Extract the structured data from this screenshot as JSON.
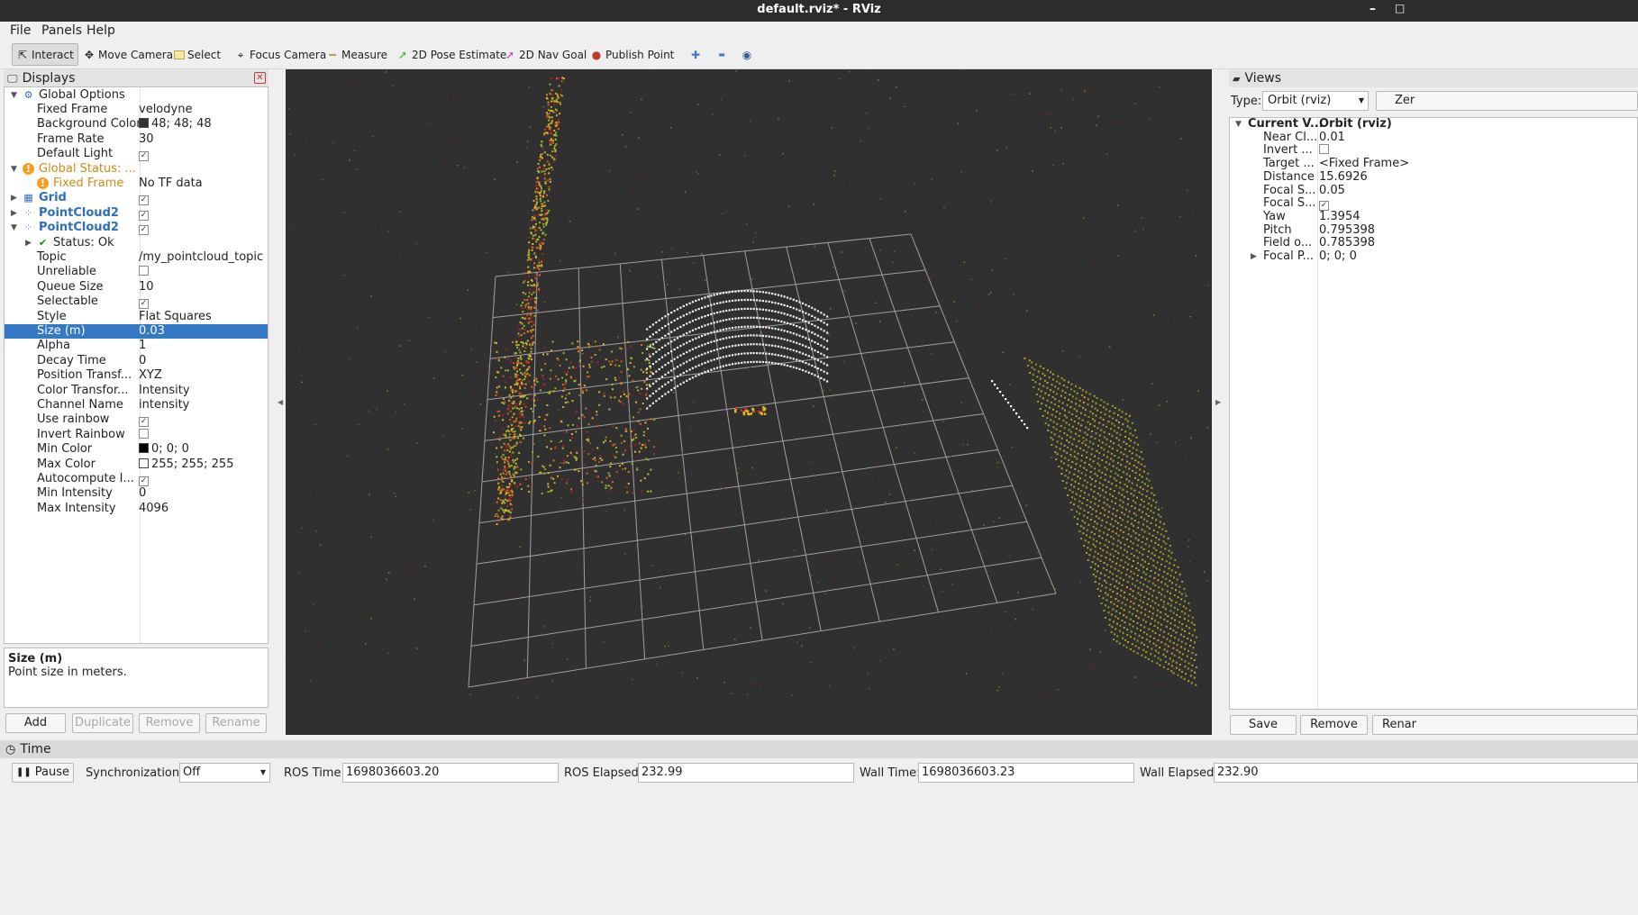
{
  "window": {
    "title": "default.rviz* - RViz",
    "min_glyph": "–",
    "max_glyph": "□"
  },
  "menu": [
    {
      "label": "File"
    },
    {
      "label": "Panels"
    },
    {
      "label": "Help"
    }
  ],
  "toolbar": {
    "tools": [
      {
        "label": "Interact",
        "icon": "cursor-icon",
        "glyph": "⇱"
      },
      {
        "label": "Move Camera",
        "icon": "move-camera-icon",
        "glyph": "✥"
      },
      {
        "label": "Select",
        "icon": "select-icon",
        "glyph": "▭"
      },
      {
        "label": "Focus Camera",
        "icon": "focus-camera-icon",
        "glyph": "⌖"
      },
      {
        "label": "Measure",
        "icon": "measure-icon",
        "glyph": "━"
      },
      {
        "label": "2D Pose Estimate",
        "icon": "pose-estimate-icon",
        "glyph": "➚"
      },
      {
        "label": "2D Nav Goal",
        "icon": "nav-goal-icon",
        "glyph": "➚"
      },
      {
        "label": "Publish Point",
        "icon": "publish-point-icon",
        "glyph": "📍"
      }
    ],
    "extra_icons": [
      {
        "name": "add-tool-icon",
        "glyph": "✚"
      },
      {
        "name": "remove-tool-icon",
        "glyph": "▬"
      },
      {
        "name": "view-options-icon",
        "glyph": "◉"
      }
    ]
  },
  "displays": {
    "title": "Displays",
    "rows": [
      {
        "name": "Global Options",
        "value": "",
        "indent": 1,
        "arrow": "▼",
        "icon": "globe-icon",
        "glyph": "⚙",
        "style": ""
      },
      {
        "name": "Fixed Frame",
        "value": "velodyne",
        "indent": 2,
        "style": ""
      },
      {
        "name": "Background Color",
        "value": "48; 48; 48",
        "indent": 2,
        "swatch": "#303030",
        "style": ""
      },
      {
        "name": "Frame Rate",
        "value": "30",
        "indent": 2,
        "style": ""
      },
      {
        "name": "Default Light",
        "value": "",
        "indent": 2,
        "check": true,
        "style": ""
      },
      {
        "name": "Global Status: ...",
        "value": "",
        "indent": 1,
        "arrow": "▼",
        "icon": "warning-icon",
        "glyph": "!",
        "style": "orange"
      },
      {
        "name": "Fixed Frame",
        "value": "No TF data",
        "indent": 2,
        "icon": "warning-icon",
        "glyph": "!",
        "style": "orange"
      },
      {
        "name": "Grid",
        "value": "",
        "indent": 1,
        "arrow": "▶",
        "icon": "grid-icon",
        "glyph": "▦",
        "check": true,
        "style": "blue"
      },
      {
        "name": "PointCloud2",
        "value": "",
        "indent": 1,
        "arrow": "▶",
        "icon": "pointcloud-icon",
        "glyph": "⁘",
        "check": true,
        "style": "blue"
      },
      {
        "name": "PointCloud2",
        "value": "",
        "indent": 1,
        "arrow": "▼",
        "icon": "pointcloud-icon",
        "glyph": "⁘",
        "check": true,
        "style": "blue"
      },
      {
        "name": "Status: Ok",
        "value": "",
        "indent": 2,
        "arrow": "▶",
        "icon": "ok-check-icon",
        "glyph": "✔",
        "style": ""
      },
      {
        "name": "Topic",
        "value": "/my_pointcloud_topic",
        "indent": 2,
        "style": ""
      },
      {
        "name": "Unreliable",
        "value": "",
        "indent": 2,
        "check": false,
        "style": ""
      },
      {
        "name": "Queue Size",
        "value": "10",
        "indent": 2,
        "style": ""
      },
      {
        "name": "Selectable",
        "value": "",
        "indent": 2,
        "check": true,
        "style": ""
      },
      {
        "name": "Style",
        "value": "Flat Squares",
        "indent": 2,
        "style": ""
      },
      {
        "name": "Size (m)",
        "value": "0.03",
        "indent": 2,
        "style": "",
        "selected": true
      },
      {
        "name": "Alpha",
        "value": "1",
        "indent": 2,
        "style": ""
      },
      {
        "name": "Decay Time",
        "value": "0",
        "indent": 2,
        "style": ""
      },
      {
        "name": "Position Transf...",
        "value": "XYZ",
        "indent": 2,
        "style": ""
      },
      {
        "name": "Color Transfor...",
        "value": "Intensity",
        "indent": 2,
        "style": ""
      },
      {
        "name": "Channel Name",
        "value": "intensity",
        "indent": 2,
        "style": ""
      },
      {
        "name": "Use rainbow",
        "value": "",
        "indent": 2,
        "check": true,
        "style": ""
      },
      {
        "name": "Invert Rainbow",
        "value": "",
        "indent": 2,
        "check": false,
        "style": ""
      },
      {
        "name": "Min Color",
        "value": "0; 0; 0",
        "indent": 2,
        "swatch": "#000000",
        "style": ""
      },
      {
        "name": "Max Color",
        "value": "255; 255; 255",
        "indent": 2,
        "swatch": "#ffffff",
        "style": ""
      },
      {
        "name": "Autocompute I...",
        "value": "",
        "indent": 2,
        "check": true,
        "style": ""
      },
      {
        "name": "Min Intensity",
        "value": "0",
        "indent": 2,
        "style": ""
      },
      {
        "name": "Max Intensity",
        "value": "4096",
        "indent": 2,
        "style": ""
      }
    ],
    "description": {
      "title": "Size (m)",
      "text": "Point size in meters."
    },
    "buttons": [
      {
        "label": "Add",
        "enabled": true
      },
      {
        "label": "Duplicate",
        "enabled": false
      },
      {
        "label": "Remove",
        "enabled": false
      },
      {
        "label": "Rename",
        "enabled": false
      }
    ]
  },
  "views": {
    "title": "Views",
    "type_label": "Type:",
    "type_value": "Orbit (rviz)",
    "zero_button": "Zer",
    "rows": [
      {
        "name": "Current V...",
        "value": "Orbit (rviz)",
        "arrow": "▼",
        "bold": true,
        "indent": 1
      },
      {
        "name": "Near Cl...",
        "value": "0.01",
        "indent": 2
      },
      {
        "name": "Invert ...",
        "value": "",
        "check": false,
        "indent": 2
      },
      {
        "name": "Target ...",
        "value": "<Fixed Frame>",
        "indent": 2
      },
      {
        "name": "Distance",
        "value": "15.6926",
        "indent": 2
      },
      {
        "name": "Focal S...",
        "value": "0.05",
        "indent": 2
      },
      {
        "name": "Focal S...",
        "value": "",
        "check": true,
        "indent": 2
      },
      {
        "name": "Yaw",
        "value": "1.3954",
        "indent": 2
      },
      {
        "name": "Pitch",
        "value": "0.795398",
        "indent": 2
      },
      {
        "name": "Field o...",
        "value": "0.785398",
        "indent": 2
      },
      {
        "name": "Focal P...",
        "value": "0; 0; 0",
        "arrow": "▶",
        "indent": 2
      }
    ],
    "buttons": [
      {
        "label": "Save"
      },
      {
        "label": "Remove"
      },
      {
        "label": "Renar"
      }
    ]
  },
  "time": {
    "title": "Time",
    "pause_label": "Pause",
    "sync_label": "Synchronization:",
    "sync_value": "Off",
    "ros_time_label": "ROS Time:",
    "ros_time": "1698036603.20",
    "ros_elapsed_label": "ROS Elapsed:",
    "ros_elapsed": "232.99",
    "wall_time_label": "Wall Time:",
    "wall_time": "1698036603.23",
    "wall_elapsed_label": "Wall Elapsed:",
    "wall_elapsed": "232.90"
  },
  "colors": {
    "viewport_bg": "#303030",
    "selection": "#3478c6",
    "grid_line": "#a0a0a0"
  }
}
